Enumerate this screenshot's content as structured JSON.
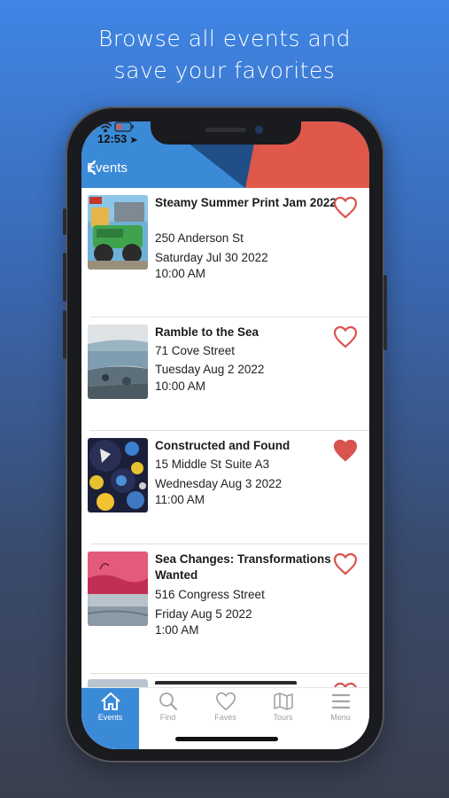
{
  "headline": {
    "line1": "Browse all events and",
    "line2": "save your favorites"
  },
  "status_bar": {
    "time": "12:53"
  },
  "nav": {
    "back_label": "Events"
  },
  "events": [
    {
      "title": "Steamy Summer Print Jam 2022",
      "address": "250 Anderson St",
      "date": "Saturday Jul 30 2022",
      "time": "10:00 AM",
      "favorited": false
    },
    {
      "title": "Ramble to the Sea",
      "address": "71 Cove Street",
      "date": "Tuesday Aug 2 2022",
      "time": "10:00 AM",
      "favorited": false
    },
    {
      "title": "Constructed and Found",
      "address": "15 Middle St Suite A3",
      "date": "Wednesday Aug 3 2022",
      "time": "11:00 AM",
      "favorited": true
    },
    {
      "title": "Sea Changes: Transformations Wanted",
      "address": "516 Congress Street",
      "date": "Friday Aug 5 2022",
      "time": "1:00 AM",
      "favorited": false
    }
  ],
  "tabs": [
    {
      "label": "Events",
      "icon": "home-icon",
      "active": true
    },
    {
      "label": "Find",
      "icon": "search-icon",
      "active": false
    },
    {
      "label": "Faves",
      "icon": "heart-icon",
      "active": false
    },
    {
      "label": "Tours",
      "icon": "map-icon",
      "active": false
    },
    {
      "label": "Menu",
      "icon": "menu-icon",
      "active": false
    }
  ],
  "colors": {
    "header_blue": "#3b8ad8",
    "header_navy": "#1f4f86",
    "accent_red": "#e0584a",
    "heart_red": "#d9534f"
  }
}
